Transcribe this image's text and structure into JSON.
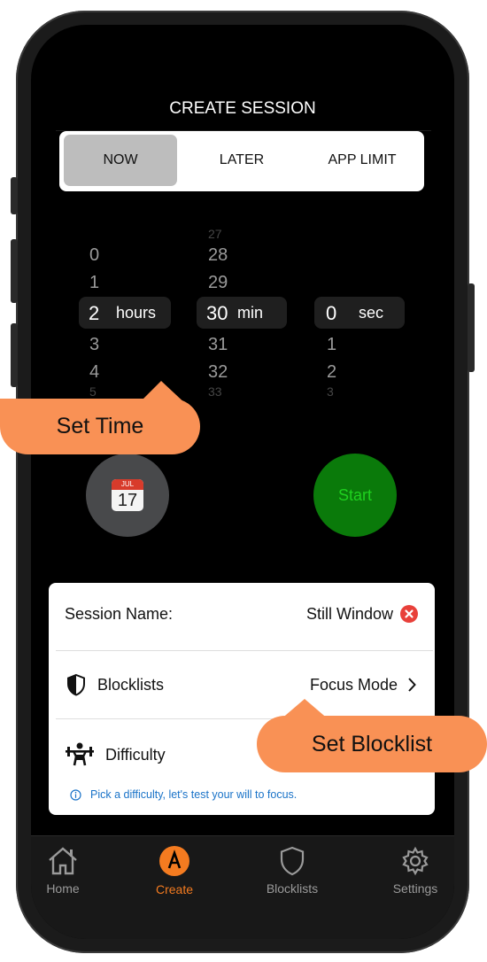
{
  "header": {
    "title": "CREATE SESSION"
  },
  "mode_tabs": [
    {
      "label": "NOW",
      "active": true
    },
    {
      "label": "LATER",
      "active": false
    },
    {
      "label": "APP LIMIT",
      "active": false
    }
  ],
  "time_picker": {
    "hours": {
      "above": [
        "0",
        "1"
      ],
      "selected": "2",
      "unit": "hours",
      "below": [
        "3",
        "4",
        "5"
      ]
    },
    "minutes": {
      "above": [
        "27",
        "28",
        "29"
      ],
      "selected": "30",
      "unit": "min",
      "below": [
        "31",
        "32",
        "33"
      ]
    },
    "seconds": {
      "above": [],
      "selected": "0",
      "unit": "sec",
      "below": [
        "1",
        "2",
        "3"
      ]
    }
  },
  "calendar_button": {
    "month": "JUL",
    "day": "17",
    "icon": "calendar-icon"
  },
  "start_button": {
    "label": "Start",
    "color": "#0a7a0a",
    "text_color": "#1fd11f"
  },
  "session_card": {
    "session_name_label": "Session Name:",
    "session_name_value": "Still Window",
    "blocklists_label": "Blocklists",
    "blocklists_value": "Focus Mode",
    "difficulty_label": "Difficulty",
    "hint": "Pick a difficulty, let's test your will to focus."
  },
  "tabbar": {
    "items": [
      {
        "label": "Home",
        "icon": "home-icon",
        "active": false
      },
      {
        "label": "Create",
        "icon": "create-icon",
        "active": true
      },
      {
        "label": "Blocklists",
        "icon": "shield-icon",
        "active": false
      },
      {
        "label": "Settings",
        "icon": "gear-icon",
        "active": false
      }
    ]
  },
  "callouts": {
    "set_time": "Set Time",
    "set_blocklist": "Set Blocklist"
  },
  "colors": {
    "accent": "#f47b20",
    "callout": "#f99155",
    "hint_blue": "#1a73c8",
    "clear_red": "#e8403a"
  }
}
